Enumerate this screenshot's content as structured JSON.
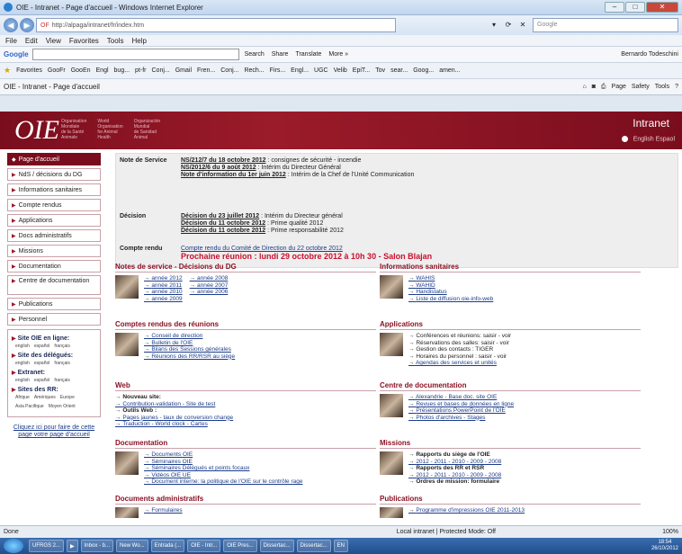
{
  "window": {
    "title": "OIE - Intranet - Page d'accueil - Windows Internet Explorer",
    "buttons": [
      "–",
      "□",
      "✕"
    ]
  },
  "address": {
    "prefix": "OF",
    "url": "http://alpaga/intranet/fr/index.htm",
    "search_placeholder": "Google"
  },
  "menu": [
    "File",
    "Edit",
    "View",
    "Favorites",
    "Tools",
    "Help"
  ],
  "googlebar": {
    "label": "Google",
    "items": [
      "Search",
      "Share",
      "Translate",
      "More »"
    ],
    "user": "Bernardo Todeschini"
  },
  "favorites": {
    "label": "Favorites",
    "items": [
      "GooFr",
      "GooEn",
      "Engl",
      "bug...",
      "pt-fr",
      "Conj...",
      "Gmail",
      "Fren...",
      "Conj...",
      "Rech...",
      "Firs...",
      "Engl...",
      "UGC",
      "Velib",
      "EpiT...",
      "Tov",
      "sear...",
      "Goog...",
      "amen..."
    ]
  },
  "tab": {
    "label": "OIE - Intranet - Page d'accueil",
    "tools": [
      "Page",
      "Safety",
      "Tools"
    ]
  },
  "banner": {
    "logo": "OIE",
    "tag1": "Organisation\nMondiale\nde la Santé\nAnimale",
    "tag2": "World\nOrganisation\nfor Animal\nHealth",
    "tag3": "Organización\nMundial\nde Sanidad\nAnimal",
    "intranet": "Intranet",
    "langs": "English  Espaol"
  },
  "nav": [
    "Page d'accueil",
    "NdS / décisions du DG",
    "Informations sanitaires",
    "Compte rendus",
    "Applications",
    "Docs administratifs",
    "Missions",
    "Documentation",
    "Centre de documentation",
    "Publications",
    "Personnel"
  ],
  "sidebox": {
    "h1": "Site OIE en ligne:",
    "l1": [
      "english",
      "español",
      "français"
    ],
    "h2": "Site des délégués:",
    "l2": [
      "english",
      "español",
      "français"
    ],
    "h3": "Extranet:",
    "l3": [
      "english",
      "español",
      "français"
    ],
    "h4": "Sites des RR:",
    "l4": [
      "Afrique",
      "Amériques",
      "Europe"
    ],
    "l5": [
      "Asia Pacifique",
      "Moyen Orient"
    ]
  },
  "cliquez": "Cliquez ici pour faire de cette page votre page d'accueil",
  "note": {
    "label": "Note de Service",
    "l1a": "NS/212/7 du 18 octobre 2012",
    "l1b": " : consignes de sécurité - incendie",
    "l2a": "NS/2012/6 du 9 août 2012",
    "l2b": " : Intérim du Directeur Général",
    "l3a": "Note d'information du 1er juin 2012",
    "l3b": " : Intérim de la Chef de l'Unité Communication"
  },
  "decision": {
    "label": "Décision",
    "l1a": "Décision du 23 juillet 2012",
    "l1b": " : Intérim du Directeur général",
    "l2a": "Décision du 11 octobre 2012",
    "l2b": " : Prime qualité 2012",
    "l3a": "Décision du 11 octobre 2012",
    "l3b": " : Prime responsabilité 2012"
  },
  "compte": {
    "label": "Compte rendu",
    "l1": "Compte rendu du Comité de Direction du 22 octobre 2012",
    "reunion": "Prochaine réunion : lundi 29 octobre 2012 à 10h 30 - Salon Blajan"
  },
  "sec": {
    "notes": {
      "title": "Notes de service - Décisions du DG",
      "items": [
        "année 2012",
        "année 2008",
        "année 2011",
        "année 2007",
        "année 2010",
        "année 2006",
        "année 2009"
      ]
    },
    "info": {
      "title": "Informations sanitaires",
      "items": [
        "WAHIS",
        "WAHID",
        "Handistatus",
        "Liste de diffusion oie-info-web"
      ]
    },
    "comptes": {
      "title": "Comptes rendus des réunions",
      "items": [
        "Conseil de direction",
        "Bulletin de l'OIE",
        "Bilans des Sessions générales",
        "Réunions des RR/RSR au siège"
      ]
    },
    "apps": {
      "title": "Applications",
      "items": [
        "Conférences et réunions: saisir - voir",
        "Réservations des salles: saisir - voir",
        "Gestion des contacts : TIGER",
        "Horaires du personnel : saisir - voir",
        "Agendas des services et unités"
      ]
    },
    "web": {
      "title": "Web",
      "items": [
        "Nouveau site:",
        "Contribution-validation - Site de test",
        "Outils Web :",
        "Pages jaunes - taux de conversion change",
        "Traduction - World clock - Cartes"
      ]
    },
    "centre": {
      "title": "Centre de documentation",
      "items": [
        "Alexandrie - Base doc. site OIE",
        "Revues et bases de données en ligne",
        "Présentations PowerPoint de l'OIE",
        "Photos d'archives - Stages"
      ]
    },
    "docu": {
      "title": "Documentation",
      "items": [
        "Documents OIE",
        "Séminaires OIE",
        "Séminaires Délégués et points focaux",
        "Vidéos OIE UE",
        "Document interne: la politique de l'OIE sur le contrôle rage"
      ]
    },
    "missions": {
      "title": "Missions",
      "r1": "Rapports du siège de l'OIE",
      "y1": "2012 - 2011 - 2010 - 2009 - 2008",
      "r2": "Rapports des RR et RSR",
      "y2": "2012 - 2011 - 2010 - 2009 - 2008",
      "ordres": "Ordres de mission: formulaire"
    },
    "admin": {
      "title": "Documents administratifs",
      "items": [
        "Formulaires"
      ]
    },
    "pubs": {
      "title": "Publications",
      "items": [
        "Programme d'impressions OIE 2011-2013"
      ]
    }
  },
  "status": {
    "left": "Done",
    "mode": "Local intranet | Protected Mode: Off",
    "zoom": "100%"
  },
  "taskbar": {
    "items": [
      "UFRGS 2...",
      "",
      "Inbox - b...",
      "New Wo...",
      "Entrada (...",
      "OIE - Intr...",
      "OIE Pres...",
      "Dissertac...",
      "Dissertac..."
    ],
    "lang": "EN",
    "time": "18:54",
    "date": "26/10/2012"
  }
}
